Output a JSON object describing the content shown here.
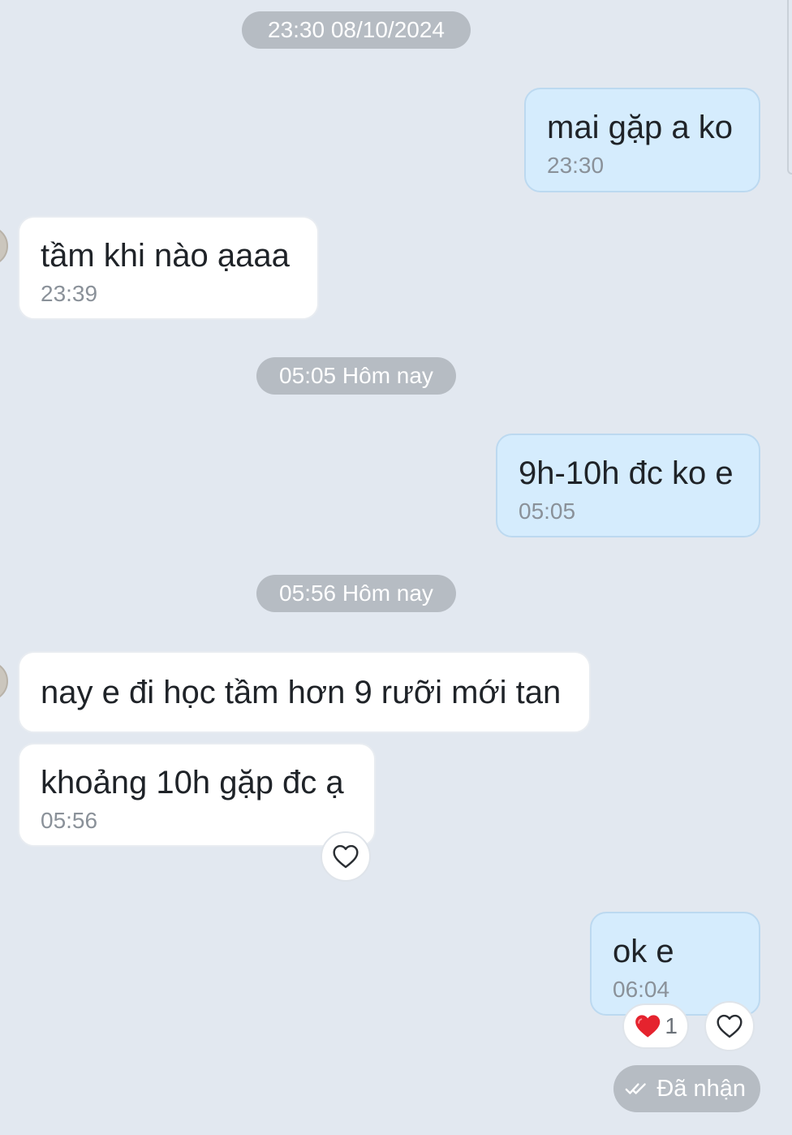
{
  "colors": {
    "background": "#e2e8f0",
    "outgoing_bubble": "#d5ecfd",
    "incoming_bubble": "#ffffff",
    "pill": "#b6bcc3",
    "heart": "#e5232e"
  },
  "separators": {
    "first": "23:30 08/10/2024",
    "second": "05:05 Hôm nay",
    "third": "05:56 Hôm nay"
  },
  "messages": {
    "m1": {
      "text": "mai gặp a ko",
      "time": "23:30",
      "direction": "outgoing"
    },
    "m2": {
      "text": "tầm khi nào ạaaa",
      "time": "23:39",
      "direction": "incoming"
    },
    "m3": {
      "text": "9h-10h đc ko e",
      "time": "05:05",
      "direction": "outgoing"
    },
    "m4": {
      "text": "nay e đi học tầm hơn 9 rưỡi mới tan",
      "direction": "incoming"
    },
    "m5": {
      "text": "khoảng 10h gặp đc ạ",
      "time": "05:56",
      "direction": "incoming"
    },
    "m6": {
      "text": "ok e",
      "time": "06:04",
      "direction": "outgoing"
    }
  },
  "reactions": {
    "m6_heart_count": "1"
  },
  "icons": {
    "like": "heart-outline-icon",
    "reaction": "red-heart-icon",
    "status": "double-check-icon"
  },
  "status": {
    "label": "Đã nhận"
  }
}
